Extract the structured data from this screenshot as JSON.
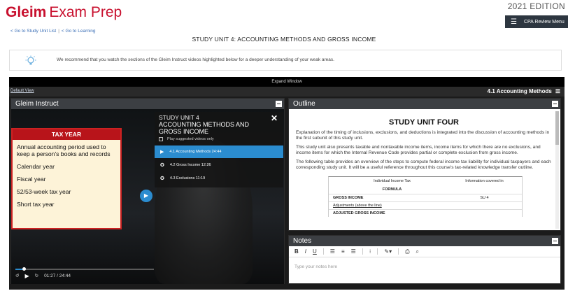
{
  "header": {
    "logo_brand": "Gleim",
    "logo_sub": "Exam Prep",
    "edition": "2021 EDITION",
    "menu_label": "CPA Review Menu"
  },
  "breadcrumbs": {
    "list_link": "< Go to Study Unit List",
    "sep": "|",
    "learning_link": "< Go to Learning"
  },
  "unit_title": "STUDY UNIT 4: ACCOUNTING METHODS AND GROSS INCOME",
  "recommendation": {
    "text": "We recommend that you watch the sections of the Gleim Instruct videos highlighted below for a deeper understanding of your weak areas."
  },
  "workspace": {
    "expand_label": "Expand Window",
    "default_view": "Default View",
    "section_label": "4.1 Accounting Methods"
  },
  "gleim_panel": {
    "title": "Gleim Instruct",
    "tax_card": {
      "header": "TAX YEAR",
      "items": [
        "Annual accounting period used to keep a person's books and records",
        "Calendar year",
        "Fiscal year",
        "52/53-week tax year",
        "Short tax year"
      ]
    },
    "video_list": {
      "unit": "STUDY UNIT 4",
      "title": "ACCOUNTING METHODS AND GROSS INCOME",
      "play_suggested": "Play suggested videos only",
      "items": [
        {
          "label": "4.1  Accounting Methods   24:44"
        },
        {
          "label": "4.2  Gross Income   12:26"
        },
        {
          "label": "4.3  Exclusions   11:19"
        }
      ]
    },
    "time": "01:27 / 24:44",
    "progress_percent": 6
  },
  "outline_panel": {
    "title": "Outline",
    "heading": "STUDY UNIT FOUR",
    "paragraphs": [
      "Explanation of the timing of inclusions, exclusions, and deductions is integrated into the discussion of accounting methods in the first subunit of this study unit.",
      "This study unit also presents taxable and nontaxable income items, income items for which there are no exclusions, and income items for which the Internal Revenue Code provides partial or complete exclusion from gross income.",
      "The following table provides an overview of the steps to compute federal income tax liability for individual taxpayers and each corresponding study unit. It will be a useful reference throughout this course's tax-related knowledge transfer outline."
    ],
    "table": {
      "col1": "Individual Income Tax",
      "col2": "Information covered in",
      "formula": "FORMULA",
      "rows": [
        {
          "label": "GROSS INCOME",
          "value": "SU 4"
        },
        {
          "label": "Adjustments (above the line)",
          "value": ""
        },
        {
          "label": "ADJUSTED GROSS INCOME",
          "value": ""
        }
      ]
    }
  },
  "notes_panel": {
    "title": "Notes",
    "placeholder": "Type your notes here",
    "toolbar": {
      "bold": "B",
      "italic": "I",
      "underline": "U"
    }
  },
  "colors": {
    "brand_red": "#c8102e",
    "accent_blue": "#2b8ccf",
    "panel_header": "#3c3f43"
  }
}
